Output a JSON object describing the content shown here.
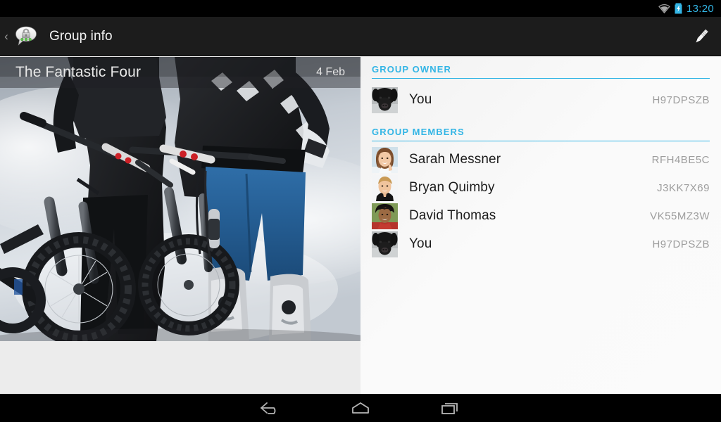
{
  "statusbar": {
    "time": "13:20",
    "icons": [
      "wifi-icon",
      "battery-charging-icon"
    ],
    "clock_color": "#33b5e5",
    "background": "#000000"
  },
  "actionbar": {
    "up_chevron": "‹",
    "app_icon": "textsecure-lock-bubble-icon",
    "title": "Group info",
    "action_icon": "edit-pencil-icon",
    "background": "#1c1c1c",
    "title_color": "#f2f2f2"
  },
  "photo": {
    "caption_title": "The Fantastic Four",
    "caption_date": "4 Feb",
    "description": "two mountain bikers standing with bikes against a cloudy sky",
    "caption_overlay": "rgba(30,32,36,0.42)"
  },
  "detail": {
    "accent_color": "#33b5e5",
    "background": "#f9f9f9",
    "sections": [
      {
        "header": "GROUP OWNER",
        "rows": [
          {
            "avatar": "black-dog-avatar",
            "name": "You",
            "id": "H97DPSZB"
          }
        ]
      },
      {
        "header": "GROUP MEMBERS",
        "rows": [
          {
            "avatar": "sarah-messner-avatar",
            "name": "Sarah Messner",
            "id": "RFH4BE5C"
          },
          {
            "avatar": "bryan-quimby-avatar",
            "name": "Bryan Quimby",
            "id": "J3KK7X69"
          },
          {
            "avatar": "david-thomas-avatar",
            "name": "David Thomas",
            "id": "VK55MZ3W"
          },
          {
            "avatar": "black-dog-avatar",
            "name": "You",
            "id": "H97DPSZB"
          }
        ]
      }
    ]
  },
  "navbar": {
    "buttons": [
      "back-icon",
      "home-icon",
      "recents-icon"
    ],
    "background": "#000000"
  }
}
